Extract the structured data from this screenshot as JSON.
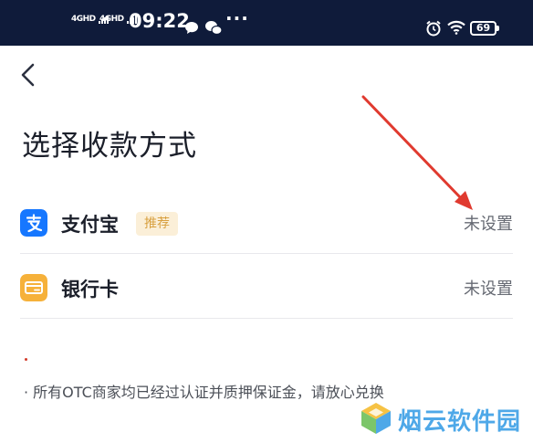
{
  "status_bar": {
    "network1": "4GHD",
    "network2": "4GHD",
    "time": "09:22",
    "more": "···",
    "battery": "69"
  },
  "header": {
    "back_icon": "chevron-left-icon"
  },
  "page": {
    "title": "选择收款方式"
  },
  "methods": [
    {
      "label": "支付宝",
      "badge": "推荐",
      "status": "未设置",
      "icon": "alipay-icon",
      "color": "#1677ff"
    },
    {
      "label": "银行卡",
      "status": "未设置",
      "icon": "bank-card-icon",
      "color": "#f6b13a"
    }
  ],
  "notice": "· 所有OTC商家均已经过认证并质押保证金，请放心兑换",
  "watermark": {
    "text": "烟云软件园"
  },
  "colors": {
    "status_bar_bg": "#0f1b3a",
    "badge_bg": "#fbefd8",
    "badge_text": "#d8a040",
    "arrow": "#e03a2f"
  }
}
